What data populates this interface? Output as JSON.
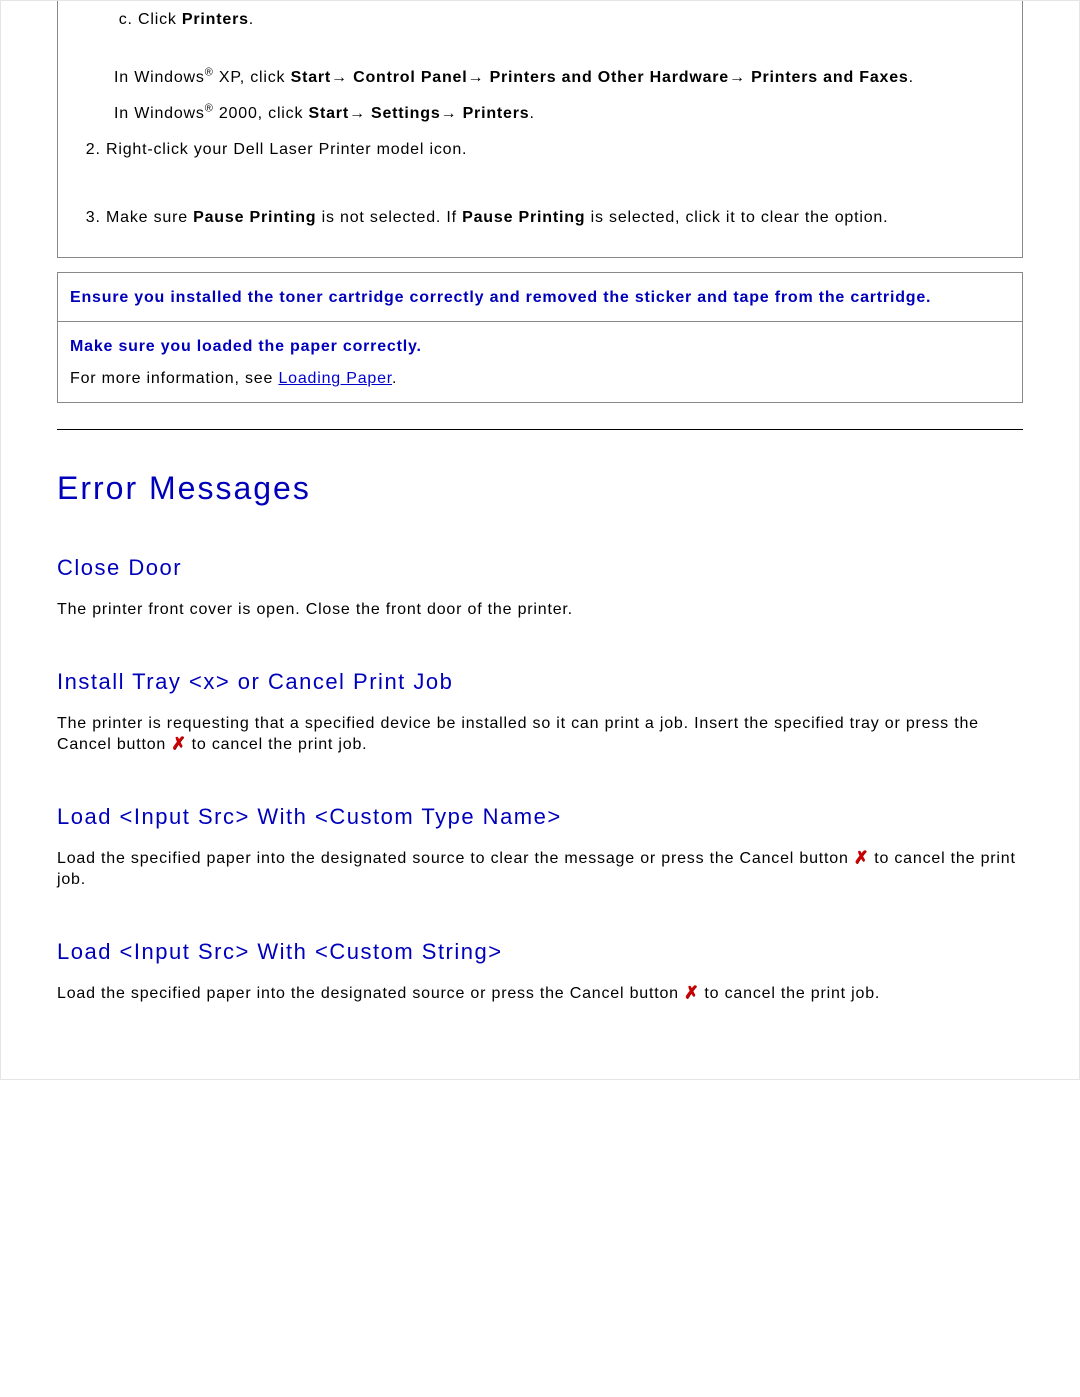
{
  "steps": {
    "c_click_label": "c.   Click ",
    "printers": "Printers",
    "period": ".",
    "xp_prefix": "In Windows",
    "reg": "®",
    "xp_text": " XP, click ",
    "start": "Start",
    "arrow": "→ ",
    "control_panel": "Control Panel",
    "printers_hw": "Printers and Other Hardware",
    "printers_faxes": "Printers and Faxes",
    "w2000_text": " 2000, click ",
    "settings": "Settings",
    "step2": "Right-click your Dell Laser Printer model icon.",
    "step3_pre": "Make sure ",
    "pause": "Pause Printing",
    "step3_mid": " is not selected. If ",
    "step3_post": " is selected, click it to clear the option."
  },
  "info": {
    "row1": "Ensure you installed the toner cartridge correctly and removed the sticker and tape from the cartridge.",
    "row2_title": "Make sure you loaded the paper correctly.",
    "row2_text_pre": "For more information, see ",
    "row2_link": "Loading Paper",
    "row2_text_post": "."
  },
  "section_title": "Error Messages",
  "errors": {
    "e1_title": "Close Door",
    "e1_body": "The printer front cover is open. Close the front door of the printer.",
    "e2_title": "Install Tray <x> or Cancel Print Job",
    "e2_body_pre": "The printer is requesting that a specified device be installed so it can print a job. Insert the specified tray or press the Cancel button ",
    "e2_body_post": " to cancel the print job.",
    "e3_title": "Load <Input Src> With <Custom Type Name>",
    "e3_body_pre": "Load the specified paper into the designated source to clear the message or press the Cancel button ",
    "e3_body_post": " to cancel the print job.",
    "e4_title": "Load <Input Src> With <Custom String>",
    "e4_body_pre": "Load the specified paper into the designated source or press the Cancel button ",
    "e4_body_post": " to cancel the print job."
  },
  "icons": {
    "x": "✗"
  }
}
